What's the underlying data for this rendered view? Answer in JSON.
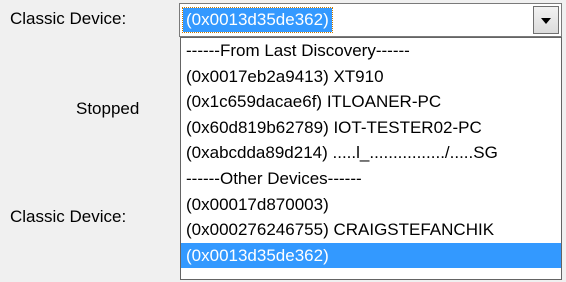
{
  "labels": {
    "classic_device_top": "Classic Device:",
    "status": "Stopped",
    "classic_device_bottom": "Classic Device:"
  },
  "combo": {
    "value": "(0x0013d35de362)",
    "dropdown_icon": "chevron-down-icon"
  },
  "dropdown": {
    "items": [
      {
        "text": "------From Last Discovery------",
        "selected": false
      },
      {
        "text": "(0x0017eb2a9413) XT910",
        "selected": false
      },
      {
        "text": "(0x1c659dacae6f) ITLOANER-PC",
        "selected": false
      },
      {
        "text": "(0x60d819b62789) IOT-TESTER02-PC",
        "selected": false
      },
      {
        "text": "(0xabcdda89d214) .....l_................/.....SG",
        "selected": false
      },
      {
        "text": "------Other Devices------",
        "selected": false
      },
      {
        "text": "(0x00017d870003)",
        "selected": false
      },
      {
        "text": "(0x000276246755) CRAIGSTEFANCHIK",
        "selected": false
      },
      {
        "text": "(0x0013d35de362)",
        "selected": true
      }
    ]
  },
  "colors": {
    "selection": "#3399ff",
    "window_bg": "#f0f0f0"
  }
}
